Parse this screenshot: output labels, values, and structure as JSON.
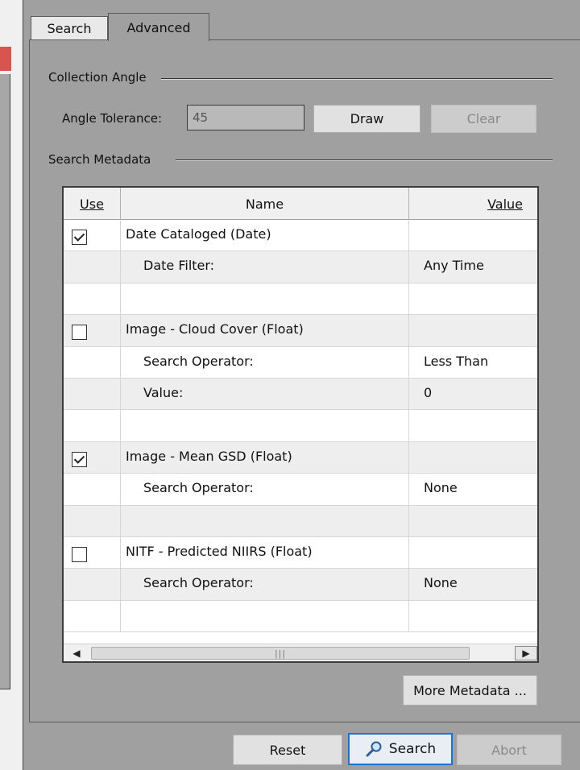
{
  "tabs": [
    {
      "label": "Search",
      "selected": false
    },
    {
      "label": "Advanced",
      "selected": true
    }
  ],
  "collection_angle": {
    "group_label": "Collection Angle",
    "tolerance_label": "Angle Tolerance:",
    "tolerance_value": "45",
    "draw_label": "Draw",
    "clear_label": "Clear"
  },
  "search_metadata": {
    "group_label": "Search Metadata",
    "columns": {
      "use": "Use",
      "name": "Name",
      "value": "Value"
    },
    "rows": [
      {
        "checkbox": true,
        "checked": true,
        "name": "Date Cataloged (Date)",
        "value": "",
        "indent": false
      },
      {
        "checkbox": false,
        "checked": false,
        "name": "Date Filter:",
        "value": "Any Time",
        "indent": true
      },
      {
        "checkbox": false,
        "checked": false,
        "name": "",
        "value": "",
        "indent": false
      },
      {
        "checkbox": true,
        "checked": false,
        "name": "Image - Cloud Cover (Float)",
        "value": "",
        "indent": false
      },
      {
        "checkbox": false,
        "checked": false,
        "name": "Search Operator:",
        "value": "Less Than",
        "indent": true
      },
      {
        "checkbox": false,
        "checked": false,
        "name": "Value:",
        "value": "0",
        "indent": true
      },
      {
        "checkbox": false,
        "checked": false,
        "name": "",
        "value": "",
        "indent": false
      },
      {
        "checkbox": true,
        "checked": true,
        "name": "Image - Mean GSD (Float)",
        "value": "",
        "indent": false
      },
      {
        "checkbox": false,
        "checked": false,
        "name": "Search Operator:",
        "value": "None",
        "indent": true
      },
      {
        "checkbox": false,
        "checked": false,
        "name": "",
        "value": "",
        "indent": false
      },
      {
        "checkbox": true,
        "checked": false,
        "name": "NITF - Predicted NIIRS (Float)",
        "value": "",
        "indent": false
      },
      {
        "checkbox": false,
        "checked": false,
        "name": "Search Operator:",
        "value": "None",
        "indent": true
      },
      {
        "checkbox": false,
        "checked": false,
        "name": "",
        "value": "",
        "indent": false
      }
    ],
    "scrollbar": {
      "left_arrow": "◀",
      "right_arrow": "▶",
      "thumb_grip": "|||"
    },
    "more_metadata_label": "More Metadata ..."
  },
  "footer": {
    "reset_label": "Reset",
    "search_label": "Search",
    "abort_label": "Abort"
  },
  "icons": {
    "search": "magnifier-icon"
  },
  "colors": {
    "accent_focus": "#1a73d8",
    "panel_bg": "#a0a0a0",
    "left_accent": "#d9534f"
  }
}
